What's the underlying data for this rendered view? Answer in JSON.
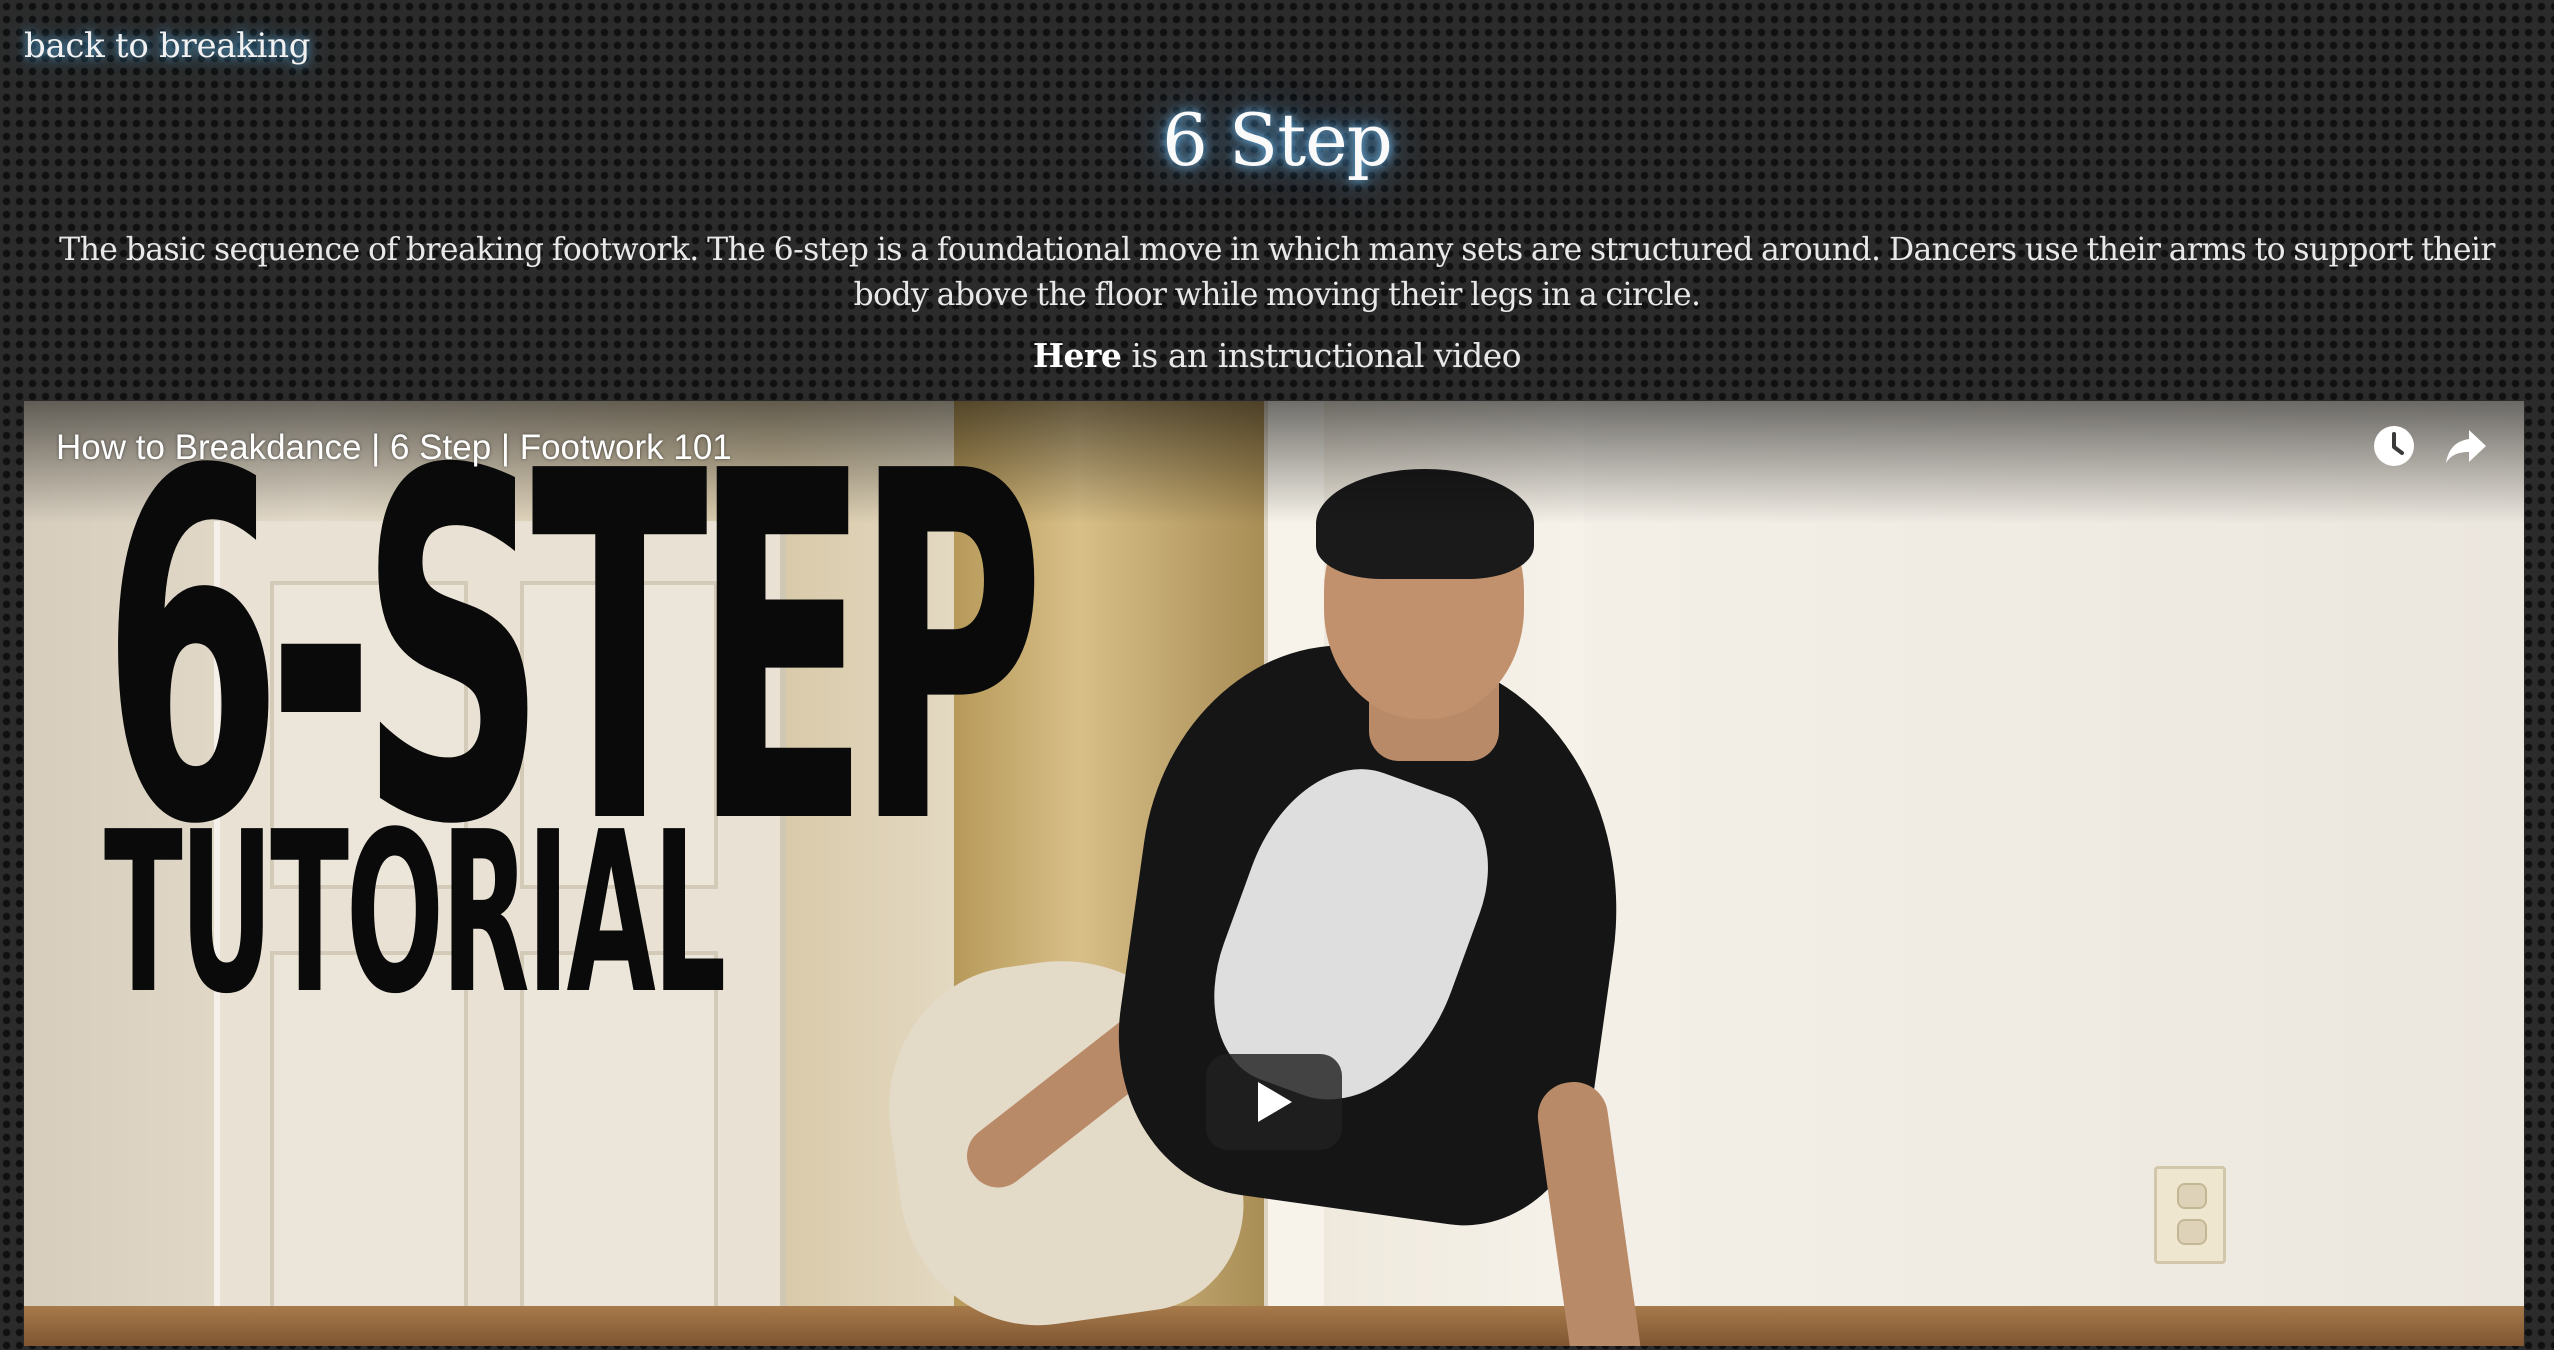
{
  "nav": {
    "back_label": "back to breaking"
  },
  "page": {
    "title": "6 Step",
    "description": "The basic sequence of breaking footwork. The 6-step is a foundational move in which many sets are structured around. Dancers use their arms to support their body above the floor while moving their legs in a circle.",
    "video_link_text": "Here",
    "video_line_rest": " is an instructional video"
  },
  "video": {
    "title": "How to Breakdance | 6 Step | Footwork 101",
    "thumbnail_headline": "6-STEP",
    "thumbnail_subtitle": "TUTORIAL",
    "icons": [
      "watch-later-icon",
      "share-icon",
      "play-icon"
    ]
  },
  "colors": {
    "glow": "#5abeff",
    "background": "#2b2b2b",
    "text": "#ececec",
    "player_button": "#212121"
  }
}
